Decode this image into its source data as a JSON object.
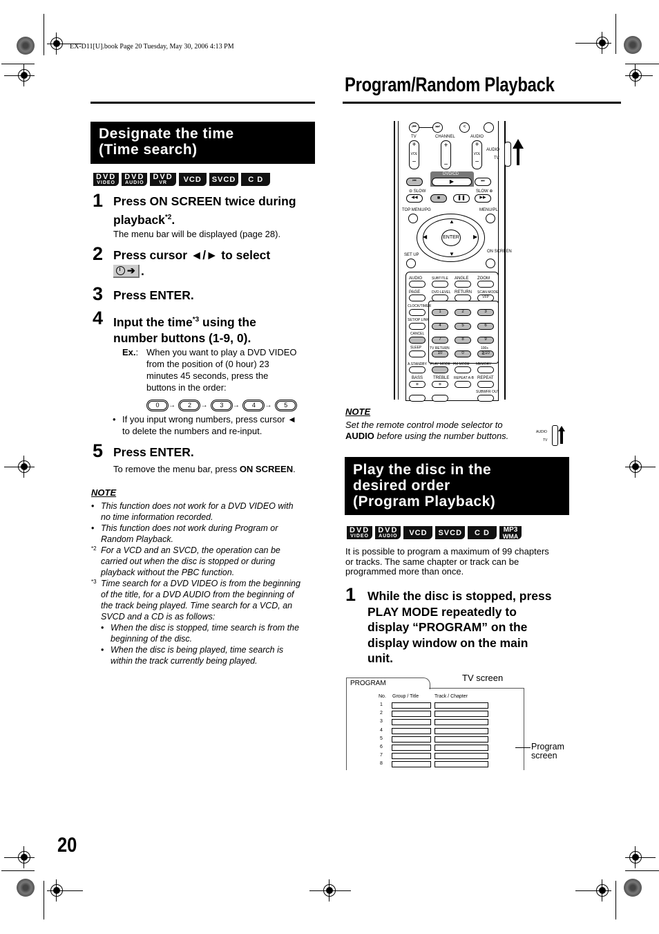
{
  "print_header": "EX-D11[U].book  Page 20  Tuesday, May 30, 2006  4:13 PM",
  "page_title": "Program/Random Playback",
  "page_number": "20",
  "left_section": {
    "title_line1": "Designate the time",
    "title_line2": "(Time search)",
    "badges": [
      {
        "top": "DVD",
        "sub": "VIDEO"
      },
      {
        "top": "DVD",
        "sub": "AUDIO"
      },
      {
        "top": "DVD",
        "sub": "VR"
      },
      {
        "top": "VCD",
        "sub": ""
      },
      {
        "top": "SVCD",
        "sub": ""
      },
      {
        "top": "C D",
        "sub": ""
      }
    ],
    "steps": [
      {
        "num": "1",
        "line1": "Press ON SCREEN twice during",
        "line2": "playback",
        "sup": "*2",
        "tail": ".",
        "detail": "The menu bar will be displayed (page 28)."
      },
      {
        "num": "2",
        "line1": "Press cursor ◄/► to select",
        "icon": "clock-arrow-icon",
        "tail": "."
      },
      {
        "num": "3",
        "line1": "Press ENTER."
      },
      {
        "num": "4",
        "line1a": "Input the time",
        "sup": "*3",
        "line1b": " using the",
        "line2": "number buttons (1-9, 0).",
        "ex_label": "Ex.",
        "ex_text": [
          "When you want to play a DVD VIDEO",
          "from the position of (0 hour) 23",
          "minutes 45 seconds, press the",
          "buttons in the order:"
        ],
        "sequence": [
          "0",
          "2",
          "3",
          "4",
          "5"
        ],
        "bullet": [
          "If you input wrong numbers, press cursor ◄",
          "to delete the numbers and re-input."
        ]
      },
      {
        "num": "5",
        "line1": "Press ENTER.",
        "detail_pre": "To remove the menu bar, press ",
        "detail_bold": "ON SCREEN",
        "detail_post": "."
      }
    ],
    "note": {
      "title": "NOTE",
      "bullets": [
        [
          "This function does not work for a DVD VIDEO with",
          "no time information recorded."
        ],
        [
          "This function does not work during Program or",
          "Random Playback."
        ]
      ],
      "footnotes": [
        {
          "mark": "*2",
          "lines": [
            "For a VCD and an SVCD, the operation can be",
            "carried out when the disc is stopped or during",
            "playback without the PBC function."
          ]
        },
        {
          "mark": "*3",
          "lines": [
            "Time search for a DVD VIDEO is from the beginning",
            "of the title, for a DVD AUDIO from the beginning of",
            "the track being played. Time search for a VCD, an",
            "SVCD and a CD is as follows:"
          ]
        }
      ],
      "sub_bullets": [
        [
          "When the disc is stopped, time search is from the",
          "beginning of the disc."
        ],
        [
          "When the disc is being played, time search is",
          "within the track currently being played."
        ]
      ]
    }
  },
  "remote": {
    "top_labels": {
      "tv": "TV",
      "channel": "CHANNEL",
      "audio": "AUDIO",
      "vol": "VOL",
      "selector_audio": "AUDIO",
      "selector_tv": "TV"
    },
    "dvdcd": "DVD/CD",
    "slow_minus": "⊖ SLOW",
    "slow_plus": "SLOW ⊕",
    "top_menu": "TOP MENU/PG",
    "menu_pl": "MENU/PL",
    "enter": "ENTER",
    "setup": "SET UP",
    "on_screen": "ON SCREEN",
    "row_labels": [
      [
        "AUDIO",
        "SUBTITLE",
        "ANGLE",
        "ZOOM"
      ],
      [
        "PAGE",
        "DVD LEVEL",
        "RETURN",
        "SCAN MODE"
      ]
    ],
    "vfp": "VFP",
    "side_labels": [
      "CLOCK/TIMER",
      "SET/OP LINK",
      "CANCEL",
      "SLEEP"
    ],
    "numbers": [
      "1",
      "2",
      "3",
      "4",
      "5",
      "6",
      "7",
      "8",
      "9",
      "10",
      "0",
      "≧10"
    ],
    "tv_return": "TV RETURN",
    "hundred": "100+",
    "bottom_labels": [
      "A.STANDBY",
      "PLAY MODE",
      "FM MODE",
      "MEMORY"
    ],
    "bass": "BASS",
    "treble": "TREBLE",
    "repeat_ab": "REPEAT A-B",
    "repeat": "REPEAT",
    "subwfr": "SUBWFR OUT",
    "plus": "+"
  },
  "right_note": {
    "title": "NOTE",
    "line1": "Set the remote control mode selector to",
    "bold": "AUDIO",
    "line2": " before using the number buttons.",
    "selector_audio": "AUDIO",
    "selector_tv": "TV"
  },
  "right_section": {
    "title_lines": [
      "Play the disc in the",
      "desired order",
      "(Program Playback)"
    ],
    "badges": [
      {
        "top": "DVD",
        "sub": "VIDEO"
      },
      {
        "top": "DVD",
        "sub": "AUDIO"
      },
      {
        "top": "VCD",
        "sub": ""
      },
      {
        "top": "SVCD",
        "sub": ""
      },
      {
        "top": "C D",
        "sub": ""
      },
      {
        "top": "MP3",
        "sub": "WMA"
      }
    ],
    "intro": [
      "It is possible to program a maximum of 99 chapters",
      "or tracks. The same chapter or track can be",
      "programmed more than once."
    ],
    "step1": {
      "num": "1",
      "lines": [
        "While the disc is stopped, press",
        "PLAY MODE repeatedly to",
        "display “PROGRAM” on the",
        "display window on the main",
        "unit."
      ]
    },
    "tv_screen_label": "TV screen",
    "program_tab": "PROGRAM",
    "columns": [
      "No.",
      "Group / Title",
      "Track / Chapter"
    ],
    "rows": [
      "1",
      "2",
      "3",
      "4",
      "5",
      "6",
      "7",
      "8"
    ],
    "program_screen_label": [
      "Program",
      "screen"
    ]
  }
}
